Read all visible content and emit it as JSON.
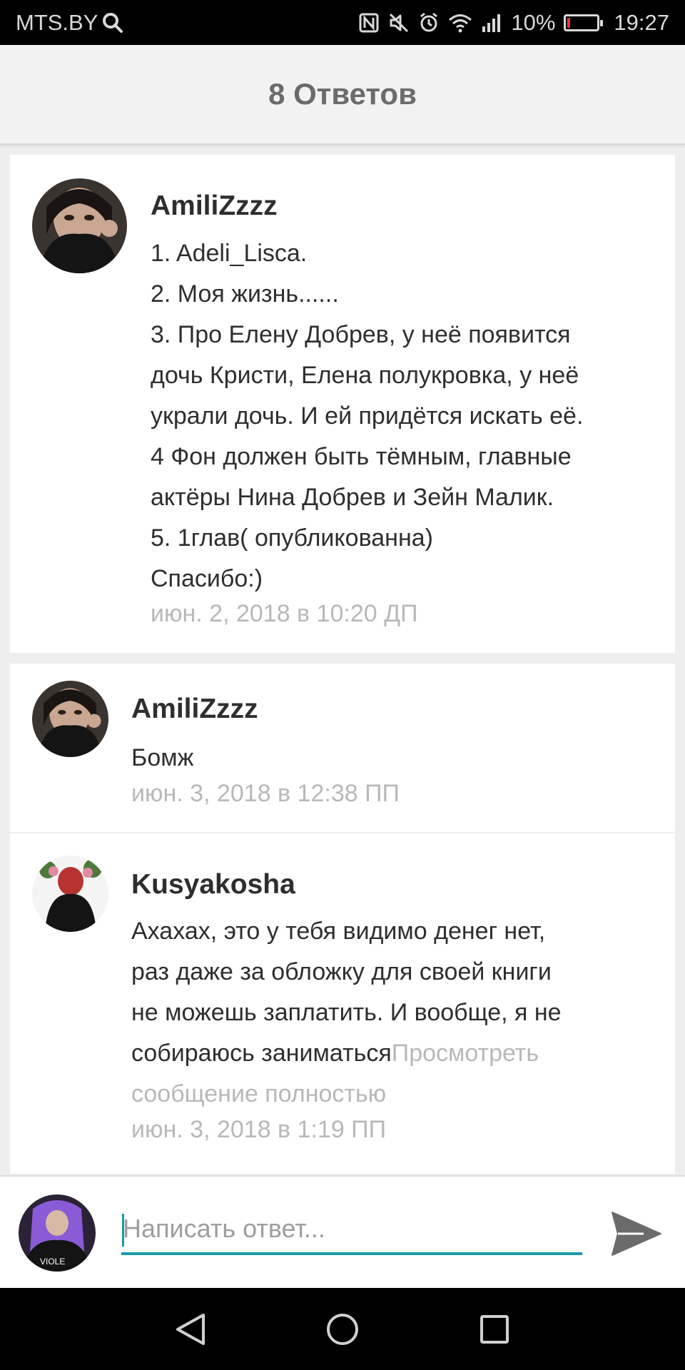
{
  "status_bar": {
    "carrier": "MTS.BY",
    "battery_percent": "10%",
    "battery_level": 0.1,
    "time": "19:27",
    "icons": [
      "search-icon",
      "nfc-icon",
      "mute-icon",
      "alarm-icon",
      "wifi-icon",
      "signal-icon",
      "battery-icon"
    ],
    "battery_color": "#ff2d2d"
  },
  "header": {
    "title": "8 Ответов"
  },
  "main_comment": {
    "username": "AmiliZzzz",
    "lines": [
      "1. Adeli_Lisca.",
      "2. Моя жизнь......",
      "3. Про Елену Добрев, у неё появится",
      "дочь Кристи, Елена полукровка,  у неё",
      "украли дочь. И ей придётся искать её.",
      "4 Фон должен быть тёмным, главные",
      "актёры Нина Добрев и Зейн Малик.",
      "5. 1глав( опубликованна)",
      "Спасибо:)"
    ],
    "timestamp": "июн. 2, 2018 в 10:20 ДП"
  },
  "replies": [
    {
      "username": "AmiliZzzz",
      "lines": [
        "Бомж"
      ],
      "timestamp": "июн. 3, 2018 в 12:38 ПП"
    },
    {
      "username": "Kusyakosha",
      "lines": [
        "Ахахах, это у тебя видимо денег нет,",
        "раз даже за обложку для своей книги",
        "не можешь заплатить. И вообще, я не"
      ],
      "last_line": "собираюсь заниматься",
      "more_link": "Просмотреть",
      "more_link_cont": "сообщение полностью",
      "timestamp": "июн. 3, 2018 в 1:19 ПП"
    }
  ],
  "composer": {
    "placeholder": "Написать ответ...",
    "accent_color": "#1a9aa8",
    "send_icon": "send-icon"
  },
  "nav_bar": {
    "icons": [
      "back-icon",
      "home-icon",
      "recents-icon"
    ]
  }
}
